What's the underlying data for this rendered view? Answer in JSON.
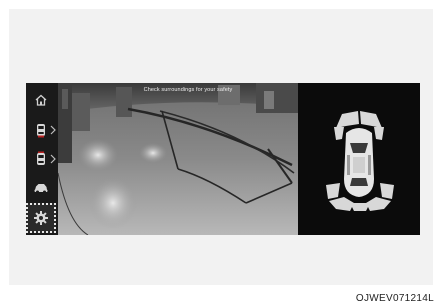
{
  "screen": {
    "warning_text": "Check surroundings for your safety"
  },
  "sidebar": {
    "items": [
      {
        "name": "home",
        "icon": "home-icon",
        "selected": false,
        "has_arrow": false
      },
      {
        "name": "rear-view",
        "icon": "car-rear-icon",
        "selected": false,
        "has_arrow": true
      },
      {
        "name": "front-view",
        "icon": "car-front-icon",
        "selected": false,
        "has_arrow": true
      },
      {
        "name": "side-view",
        "icon": "car-side-icon",
        "selected": false,
        "has_arrow": false
      },
      {
        "name": "settings",
        "icon": "gear-icon",
        "selected": true,
        "has_arrow": false
      }
    ]
  },
  "figure_code": "OJWEV071214L",
  "colors": {
    "screen_bg": "#101010",
    "sensor_segment": "#d8d8d8",
    "car_body": "#e6e6e6",
    "selection_outline": "#e8e8e8"
  }
}
